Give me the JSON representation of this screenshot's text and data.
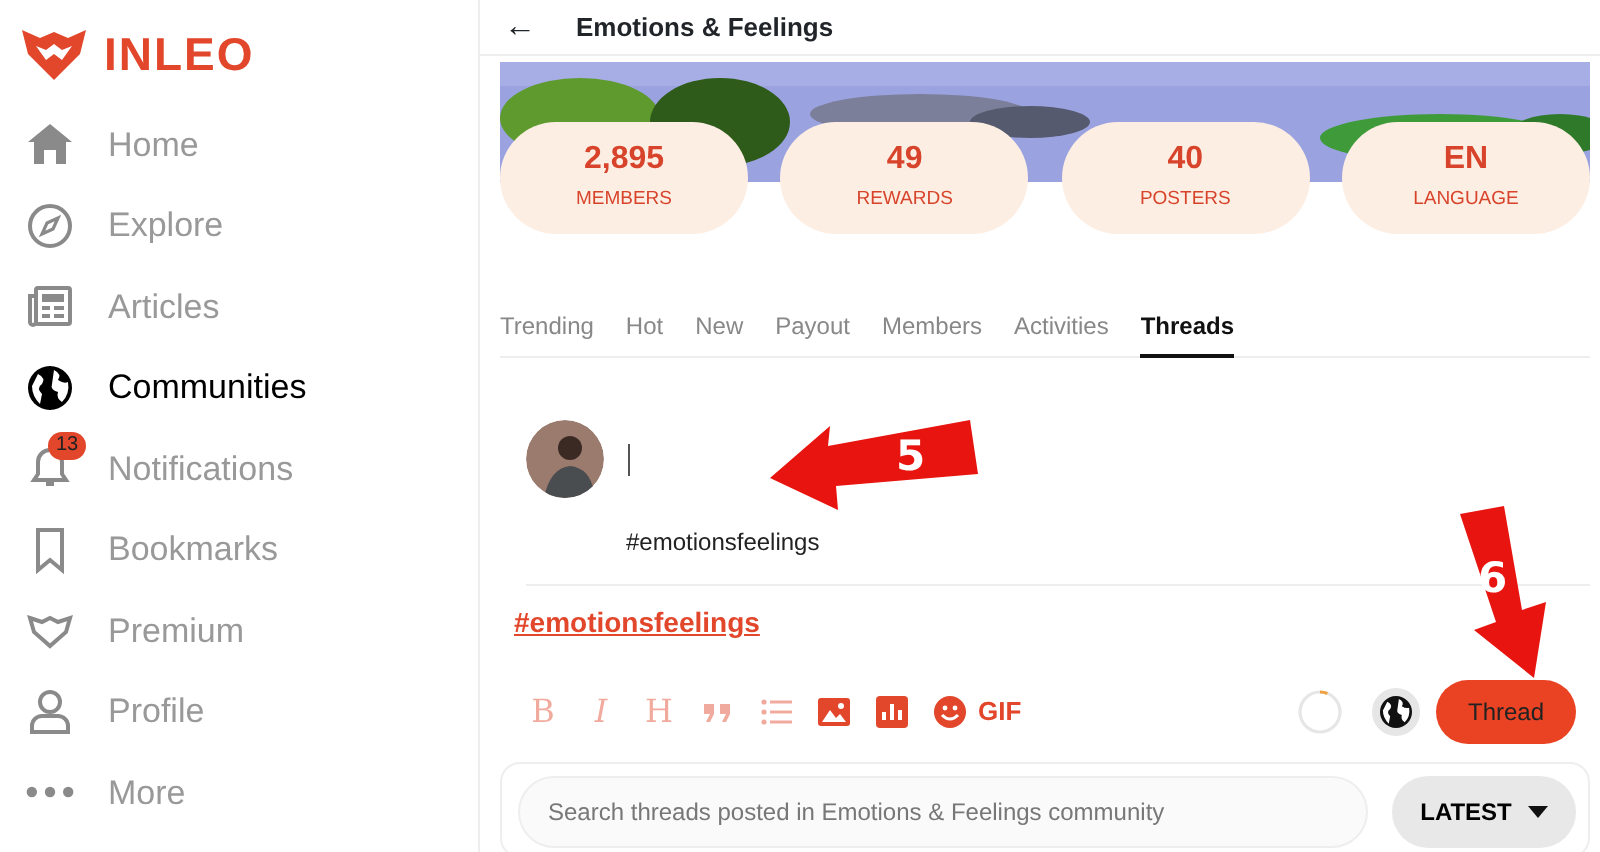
{
  "logo": {
    "text": "INLEO"
  },
  "sidebar": {
    "items": [
      {
        "label": "Home",
        "selected": false
      },
      {
        "label": "Explore",
        "selected": false
      },
      {
        "label": "Articles",
        "selected": false
      },
      {
        "label": "Communities",
        "selected": true
      },
      {
        "label": "Notifications",
        "selected": false,
        "badge": "13"
      },
      {
        "label": "Bookmarks",
        "selected": false
      },
      {
        "label": "Premium",
        "selected": false
      },
      {
        "label": "Profile",
        "selected": false
      },
      {
        "label": "More",
        "selected": false
      }
    ]
  },
  "header": {
    "back": "←",
    "title": "Emotions & Feelings"
  },
  "stats": [
    {
      "value": "2,895",
      "label": "MEMBERS"
    },
    {
      "value": "49",
      "label": "REWARDS"
    },
    {
      "value": "40",
      "label": "POSTERS"
    },
    {
      "value": "EN",
      "label": "LANGUAGE"
    }
  ],
  "tabs": [
    {
      "label": "Trending",
      "selected": false
    },
    {
      "label": "Hot",
      "selected": false
    },
    {
      "label": "New",
      "selected": false
    },
    {
      "label": "Payout",
      "selected": false
    },
    {
      "label": "Members",
      "selected": false
    },
    {
      "label": "Activities",
      "selected": false
    },
    {
      "label": "Threads",
      "selected": true
    }
  ],
  "composer": {
    "hashtag_text": "#emotionsfeelings",
    "community_tag": "#emotionsfeelings",
    "tools": [
      {
        "kind": "glyph",
        "label": "B",
        "disabled": true
      },
      {
        "kind": "glyph",
        "label": "I",
        "disabled": true
      },
      {
        "kind": "glyph",
        "label": "H",
        "disabled": true
      },
      {
        "kind": "icon",
        "disabled": true
      },
      {
        "kind": "icon",
        "disabled": true
      },
      {
        "kind": "icon",
        "disabled": false
      },
      {
        "kind": "icon",
        "disabled": false
      },
      {
        "kind": "icon",
        "disabled": false
      },
      {
        "kind": "glyph",
        "label": "GIF",
        "disabled": false
      }
    ],
    "char_meter": {
      "level": 0.06
    },
    "submit": "Thread"
  },
  "search": {
    "placeholder": "Search threads posted in Emotions & Feelings community",
    "sort": "LATEST"
  },
  "annotations": [
    {
      "label": "5"
    },
    {
      "label": "6"
    }
  ]
}
